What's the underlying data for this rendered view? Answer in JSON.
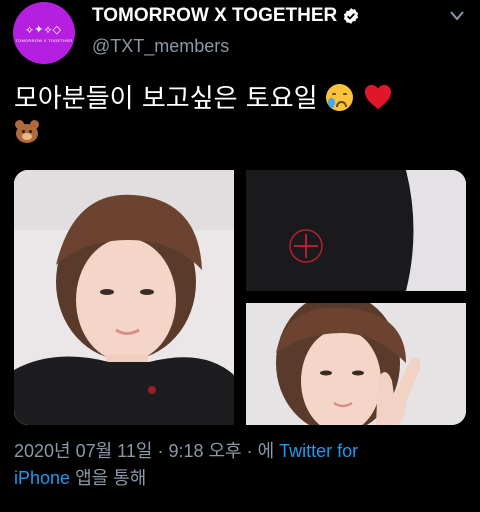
{
  "account": {
    "display_name": "TOMORROW X TOGETHER",
    "handle": "@TXT_members",
    "avatar_logo_text": "TOMORROW X TOGETHER",
    "avatar_color": "#b51fe0",
    "verified_icon": "verified-badge-icon"
  },
  "tweet": {
    "text": "모아분들이 보고싶은 토요일",
    "emojis": [
      "crying-face-emoji",
      "red-heart-emoji",
      "bear-face-emoji"
    ]
  },
  "media": {
    "photos": [
      "photo-selfie-peace",
      "photo-black-shirt-logo",
      "photo-selfie-peace-sign"
    ]
  },
  "meta": {
    "date": "2020년 07월 11일",
    "sep1": " · ",
    "time": "9:18 오후",
    "sep2": " · ",
    "prefix": "에 ",
    "source_part1": "Twitter for",
    "source_part2": "iPhone",
    "suffix": " 앱을 통해"
  },
  "colors": {
    "background": "#000000",
    "secondary_text": "#8b98a5",
    "link": "#1d9bf0"
  }
}
